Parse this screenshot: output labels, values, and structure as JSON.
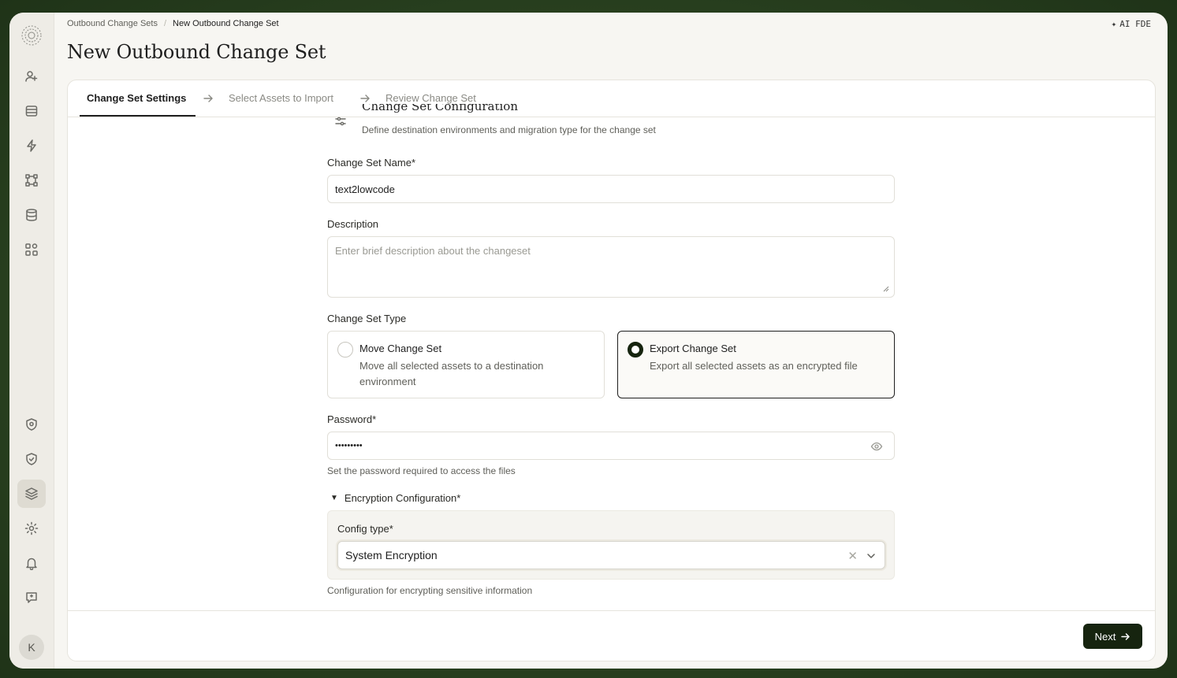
{
  "breadcrumb": {
    "parent": "Outbound Change Sets",
    "current": "New Outbound Change Set"
  },
  "ai_badge": "AI FDE",
  "page_title": "New Outbound Change Set",
  "user": {
    "avatar_initial": "K"
  },
  "tabs": [
    {
      "label": "Change Set Settings",
      "active": true
    },
    {
      "label": "Select Assets to Import",
      "active": false
    },
    {
      "label": "Review Change Set",
      "active": false
    }
  ],
  "section": {
    "title": "Change Set Configuration",
    "description": "Define destination environments and migration type for the change set"
  },
  "fields": {
    "name": {
      "label": "Change Set Name*",
      "value": "text2lowcode"
    },
    "description": {
      "label": "Description",
      "placeholder": "Enter brief description about the changeset"
    },
    "type": {
      "label": "Change Set Type",
      "options": [
        {
          "title": "Move Change Set",
          "description": "Move all selected assets to a destination environment",
          "selected": false
        },
        {
          "title": "Export Change Set",
          "description": "Export all selected assets as an encrypted file",
          "selected": true
        }
      ]
    },
    "password": {
      "label": "Password*",
      "value": "•••••••••",
      "help": "Set the password required to access the files"
    },
    "encryption": {
      "label": "Encryption Configuration*",
      "config_type_label": "Config type*",
      "config_type_value": "System Encryption",
      "help": "Configuration for encrypting sensitive information"
    }
  },
  "footer": {
    "next_label": "Next"
  },
  "colors": {
    "primary": "#16240f",
    "background": "#f7f6f2",
    "frame": "#2a4220"
  }
}
